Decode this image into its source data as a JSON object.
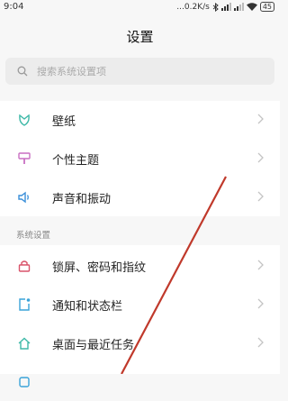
{
  "status_bar": {
    "time": "9:04",
    "net_speed": "...0.2K/s",
    "battery": "45"
  },
  "header": {
    "title": "设置"
  },
  "search": {
    "placeholder": "搜索系统设置项"
  },
  "groups": [
    {
      "items": [
        {
          "label": "壁纸",
          "icon": "wallpaper-icon",
          "color": "#3fb9a8"
        },
        {
          "label": "个性主题",
          "icon": "theme-brush-icon",
          "color": "#c96fc2"
        },
        {
          "label": "声音和振动",
          "icon": "speaker-icon",
          "color": "#3a8fd9"
        }
      ]
    },
    {
      "header": "系统设置",
      "items": [
        {
          "label": "锁屏、密码和指纹",
          "icon": "lock-icon",
          "color": "#d9536a"
        },
        {
          "label": "通知和状态栏",
          "icon": "notification-icon",
          "color": "#3aa3d9"
        },
        {
          "label": "桌面与最近任务",
          "icon": "home-icon",
          "color": "#3fb9a8"
        }
      ]
    }
  ],
  "overlay": {
    "annotation_line_color": "#c0392b"
  }
}
